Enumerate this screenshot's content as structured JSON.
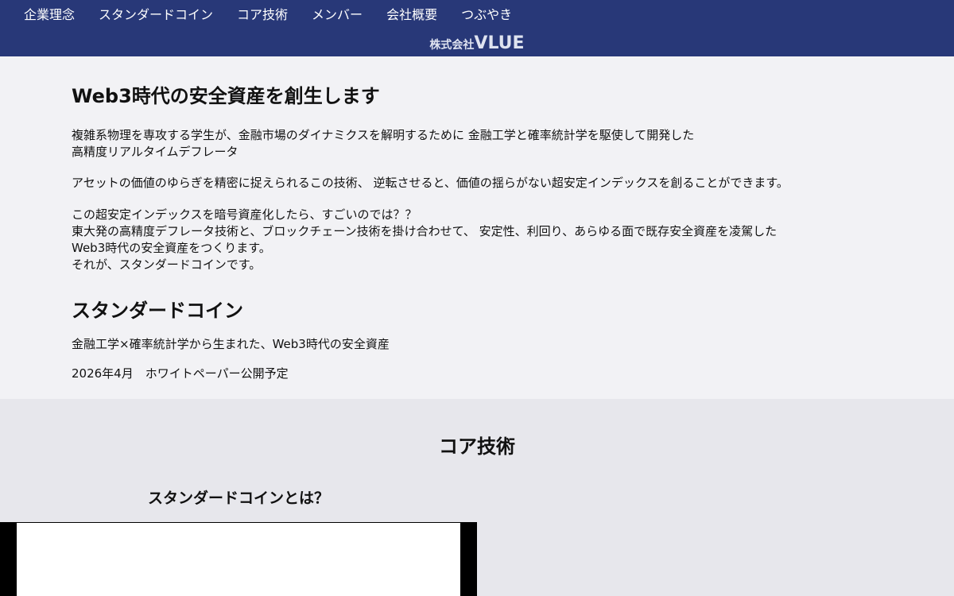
{
  "header": {
    "nav": [
      {
        "label": "企業理念"
      },
      {
        "label": "スタンダードコイン"
      },
      {
        "label": "コア技術"
      },
      {
        "label": "メンバー"
      },
      {
        "label": "会社概要"
      },
      {
        "label": "つぶやき"
      }
    ],
    "brand_prefix": "株式会社",
    "brand_name": "VLUE"
  },
  "intro": {
    "title": "Web3時代の安全資産を創生します",
    "p1": [
      "複雑系物理を専攻する学生が、金融市場のダイナミクスを解明するために 金融工学と確率統計学を駆使して開発した",
      "高精度リアルタイムデフレータ"
    ],
    "p2": "アセットの価値のゆらぎを精密に捉えられるこの技術、 逆転させると、価値の揺らがない超安定インデックスを創ることができます。",
    "p3": [
      "この超安定インデックスを暗号資産化したら、すごいのでは？？",
      "東大発の高精度デフレータ技術と、ブロックチェーン技術を掛け合わせて、 安定性、利回り、あらゆる面で既存安全資産を凌駕した",
      "Web3時代の安全資産をつくります。",
      "それが、スタンダードコインです。"
    ]
  },
  "standard_coin": {
    "title": "スタンダードコイン",
    "tagline": "金融工学×確率統計学から生まれた、Web3時代の安全資産",
    "schedule": "2026年4月　ホワイトペーパー公開予定"
  },
  "core_tech": {
    "title": "コア技術",
    "subtitle": "スタンダードコインとは？"
  }
}
